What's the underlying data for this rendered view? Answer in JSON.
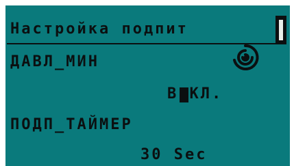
{
  "screen": {
    "title": "Настройка подпит",
    "status_icon": "bracket-cursor-icon"
  },
  "params": [
    {
      "label": "ДАВЛ_МИН",
      "value_left": "В",
      "value_right": "КЛ.",
      "icon": "spinning-refresh-icon"
    },
    {
      "label": "ПОДП_ТАЙМЕР",
      "value": "30 Sec"
    }
  ],
  "colors": {
    "lcd_background": "#0a7a7c",
    "lcd_text": "#0b0f10",
    "frame": "#ffffff"
  }
}
